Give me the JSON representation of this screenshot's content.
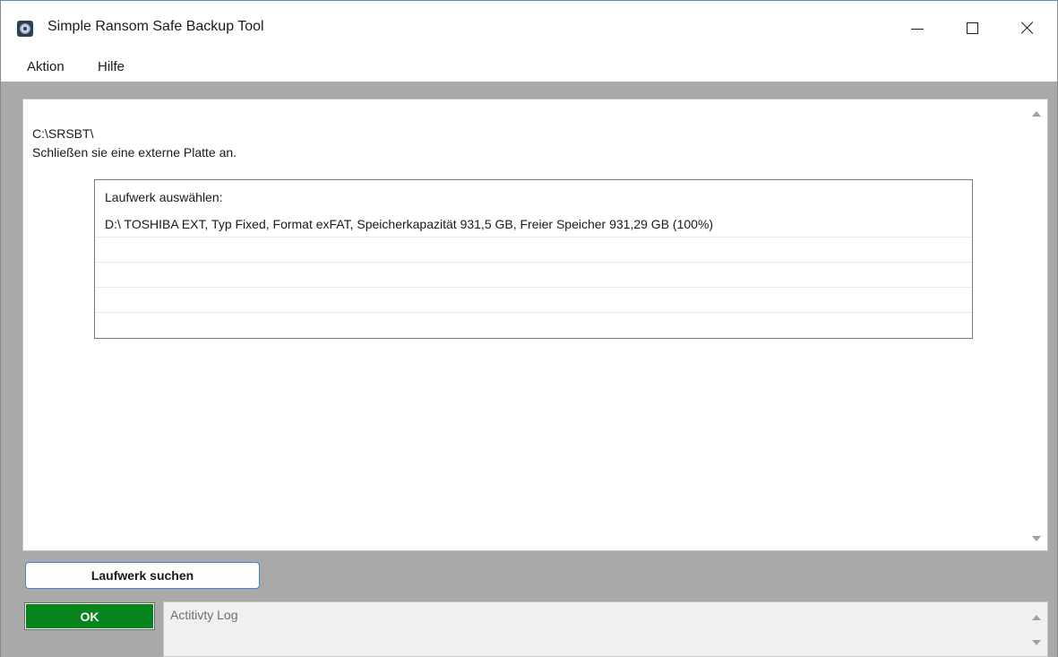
{
  "window": {
    "title": "Simple Ransom Safe Backup Tool",
    "icon": "app-disc-icon"
  },
  "menu": {
    "items": [
      {
        "label": "Aktion"
      },
      {
        "label": "Hilfe"
      }
    ]
  },
  "main": {
    "path": "C:\\SRSBT\\",
    "hint": "Schließen sie eine externe Platte an.",
    "drive_list": {
      "caption": "Laufwerk auswählen:",
      "rows": [
        "D:\\ TOSHIBA EXT, Typ Fixed, Format exFAT, Speicherkapazität 931,5 GB, Freier Speicher 931,29 GB (100%)",
        "",
        "",
        ""
      ]
    }
  },
  "buttons": {
    "search_label": "Laufwerk suchen"
  },
  "status": {
    "label": "OK",
    "color": "#08841c"
  },
  "log": {
    "placeholder": "Actitivty Log"
  },
  "colors": {
    "accent": "#3d86d6",
    "client_background": "#a9a9a9"
  }
}
